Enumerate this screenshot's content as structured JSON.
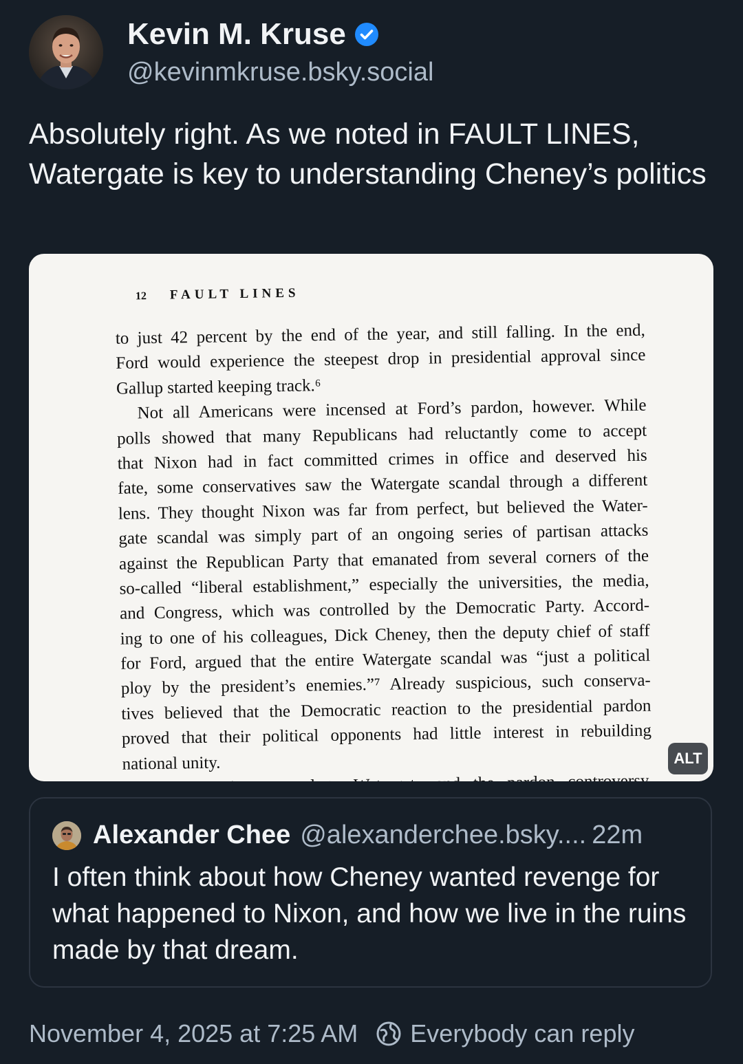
{
  "post": {
    "author": {
      "display_name": "Kevin M. Kruse",
      "handle": "@kevinmkruse.bsky.social",
      "verified": true
    },
    "text": "Absolutely right. As we noted in FAULT LINES, Watergate is key to understanding Cheney’s politics",
    "image": {
      "page_number": "12",
      "running_head": "FAULT LINES",
      "lines": [
        "to just 42 percent by the end of the year, and still falling. In the end,",
        "Ford would experience the steepest drop in presidential approval since",
        "Gallup started keeping track.⁶",
        "Not all Americans were incensed at Ford’s pardon, however. While",
        "polls showed that many Republicans had reluctantly come to accept",
        "that Nixon had in fact committed crimes in office and deserved his",
        "fate, some conservatives saw the Watergate scandal through a different",
        "lens. They thought Nixon was far from perfect, but believed the Water-",
        "gate scandal was simply part of an ongoing series of partisan attacks",
        "against the Republican Party that emanated from several corners of the",
        "so-called “liberal establishment,” especially the universities, the media,",
        "and Congress, which was controlled by the Democratic Party. Accord-",
        "ing to one of his colleagues, Dick Cheney, then the deputy chief of staff",
        "for Ford, argued that the entire Watergate scandal was “just a political",
        "ploy by the president’s enemies.”⁷ Already suspicious, such conserva-",
        "tives believed that the Democratic reaction to the presidential pardon",
        "proved that their political opponents had little interest in rebuilding",
        "national unity.",
        "As the nation reacted to Watergate and the pardon controversy,"
      ],
      "alt_label": "ALT"
    },
    "quote": {
      "display_name": "Alexander Chee",
      "handle": "@alexanderchee.bsky....",
      "time": "22m",
      "text": "I often think about how Cheney wanted revenge for what happened to Nixon, and how we live in the ruins made by that dream."
    },
    "timestamp": "November 4, 2025 at 7:25 AM",
    "reply_setting": "Everybody can reply"
  },
  "colors": {
    "background": "#161e27",
    "text_primary": "#f1f3f5",
    "text_secondary": "#aebbc9",
    "verified_blue": "#208bfe",
    "border": "#2c3440"
  }
}
